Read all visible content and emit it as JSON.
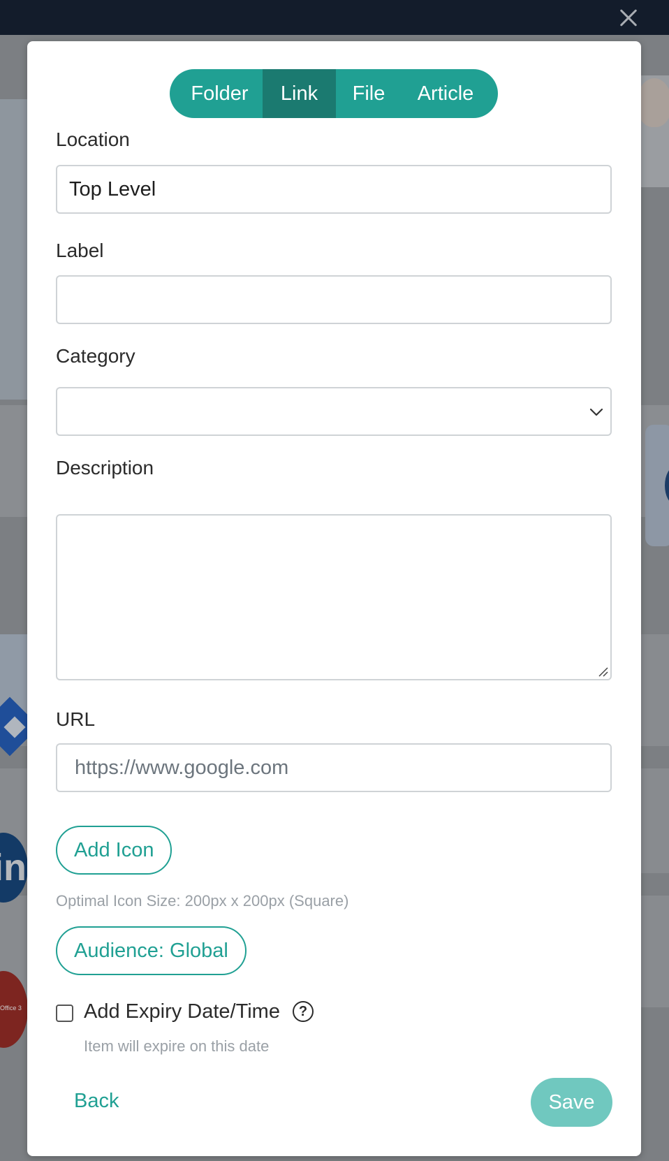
{
  "modal": {
    "type_tabs": [
      {
        "label": "Folder",
        "active": false
      },
      {
        "label": "Link",
        "active": true
      },
      {
        "label": "File",
        "active": false
      },
      {
        "label": "Article",
        "active": false
      }
    ],
    "fields": {
      "location": {
        "label": "Location",
        "value": "Top Level"
      },
      "label": {
        "label": "Label",
        "value": ""
      },
      "category": {
        "label": "Category",
        "value": ""
      },
      "description": {
        "label": "Description",
        "value": ""
      },
      "url": {
        "label": "URL",
        "placeholder": "https://www.google.com",
        "value": ""
      }
    },
    "add_icon": {
      "label": "Add Icon",
      "hint": "Optimal Icon Size: 200px x 200px (Square)"
    },
    "audience": {
      "label": "Audience: Global"
    },
    "expiry": {
      "label": "Add Expiry Date/Time",
      "hint": "Item will expire on this date",
      "checked": false,
      "help_icon": "question-circle-icon"
    },
    "footer": {
      "back_label": "Back",
      "save_label": "Save"
    }
  },
  "colors": {
    "accent": "#20a093",
    "accent_active": "#1b7a70",
    "save_disabled": "#70c8bf",
    "topbar": "#131c2b"
  },
  "backdrop": {
    "close_icon": "close-icon",
    "office_tile_text": "Office 3"
  }
}
